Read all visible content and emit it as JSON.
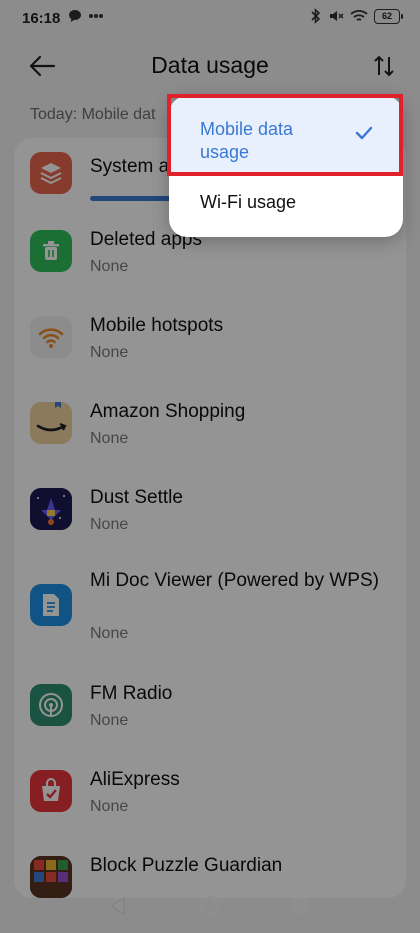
{
  "status_bar": {
    "time": "16:18",
    "battery": "62"
  },
  "header": {
    "title": "Data usage"
  },
  "subtitle": "Today: Mobile dat",
  "apps": [
    {
      "name": "System a",
      "usage": "",
      "icon": "layers-icon",
      "color": "#e8664e",
      "progress": 0.7
    },
    {
      "name": "Deleted apps",
      "usage": "None",
      "icon": "trash-icon",
      "color": "#2fbf5c"
    },
    {
      "name": "Mobile hotspots",
      "usage": "None",
      "icon": "hotspot-icon",
      "color": "#f2f2f2"
    },
    {
      "name": "Amazon Shopping",
      "usage": "None",
      "icon": "amazon-icon",
      "color": "#f3d7a7"
    },
    {
      "name": "Dust Settle",
      "usage": "None",
      "icon": "game-icon",
      "color": "#1b1b4a"
    },
    {
      "name": "Mi Doc Viewer (Powered by WPS)",
      "usage": "None",
      "icon": "document-icon",
      "color": "#1e8fe6"
    },
    {
      "name": "FM Radio",
      "usage": "None",
      "icon": "radio-icon",
      "color": "#2e8f70"
    },
    {
      "name": "AliExpress",
      "usage": "None",
      "icon": "aliexpress-icon",
      "color": "#e8353b"
    },
    {
      "name": "Block Puzzle Guardian",
      "usage": "",
      "icon": "puzzle-icon",
      "color": "#6b3f2a"
    }
  ],
  "menu": {
    "options": [
      {
        "label": "Mobile data usage",
        "selected": true
      },
      {
        "label": "Wi-Fi usage",
        "selected": false
      }
    ],
    "accent": "#3a78d6",
    "highlight_color": "#e0202a"
  }
}
